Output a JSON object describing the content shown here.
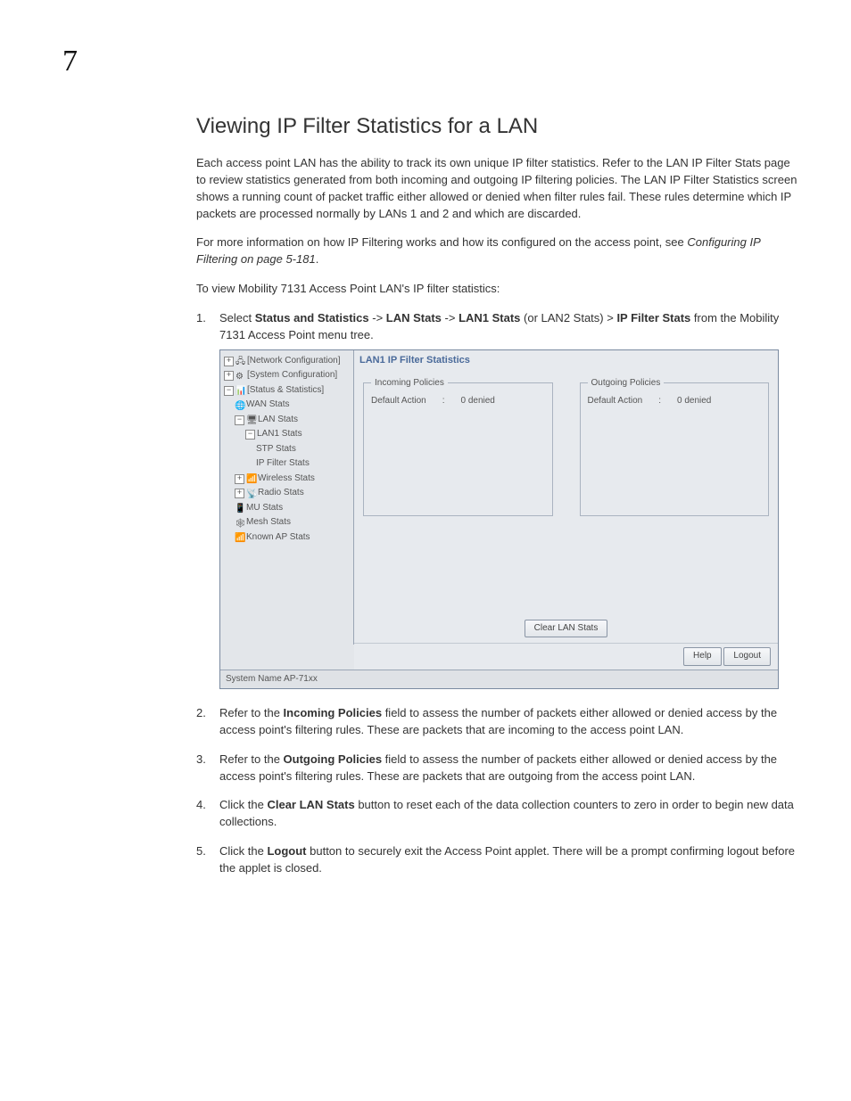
{
  "chapter": "7",
  "heading": "Viewing IP Filter Statistics for a LAN",
  "para1": "Each access point LAN has the ability to track its own unique IP filter statistics. Refer to the LAN IP Filter Stats page to review statistics generated from both incoming and outgoing IP filtering policies. The LAN IP Filter Statistics screen shows a running count of packet traffic either allowed or denied when filter rules fail. These rules determine which IP packets are processed normally by LANs 1 and 2 and which are discarded.",
  "para2a": "For more information on how IP Filtering works and how its configured on the access point, see ",
  "para2b_ital": "Configuring IP Filtering on page 5-181",
  "para2c": ".",
  "para3": "To view Mobility 7131 Access Point LAN's IP filter statistics:",
  "step1": {
    "num": "1.",
    "a": "Select ",
    "b1": "Status and Statistics",
    "s1": " -> ",
    "b2": "LAN Stats",
    "s2": " -> ",
    "b3": "LAN1 Stats",
    "s3": " (or LAN2 Stats) > ",
    "b4": "IP Filter Stats",
    "s4": " from the Mobility 7131 Access Point menu tree."
  },
  "screenshot": {
    "title": "LAN1 IP Filter Statistics",
    "incoming_legend": "Incoming Policies",
    "outgoing_legend": "Outgoing Policies",
    "default_action_label": "Default Action",
    "colon": ":",
    "incoming_value": "0 denied",
    "outgoing_value": "0 denied",
    "clear_btn": "Clear LAN Stats",
    "help_btn": "Help",
    "logout_btn": "Logout",
    "footer": "System Name AP-71xx",
    "tree": {
      "n0": "[Network Configuration]",
      "n1": "[System Configuration]",
      "n2": "[Status & Statistics]",
      "n3": "WAN Stats",
      "n4": "LAN Stats",
      "n5": "LAN1 Stats",
      "n6": "STP Stats",
      "n7": "IP Filter Stats",
      "n8": "Wireless Stats",
      "n9": "Radio Stats",
      "n10": "MU Stats",
      "n11": "Mesh Stats",
      "n12": "Known AP Stats"
    },
    "exp_plus": "+",
    "exp_minus": "−"
  },
  "step2": {
    "num": "2.",
    "a": "Refer to the ",
    "b": "Incoming Policies",
    "c": " field to assess the number of packets either allowed or denied access by the access point's filtering rules. These are packets that are incoming to the access point LAN."
  },
  "step3": {
    "num": "3.",
    "a": "Refer to the ",
    "b": "Outgoing Policies",
    "c": " field to assess the number of packets either allowed or denied access by the access point's filtering rules. These are packets that are outgoing from the access point LAN."
  },
  "step4": {
    "num": "4.",
    "a": "Click the ",
    "b": "Clear LAN Stats",
    "c": " button to reset each of the data collection counters to zero in order to begin new data collections."
  },
  "step5": {
    "num": "5.",
    "a": "Click the ",
    "b": "Logout",
    "c": " button to securely exit the Access Point applet. There will be a prompt confirming logout before the applet is closed."
  }
}
